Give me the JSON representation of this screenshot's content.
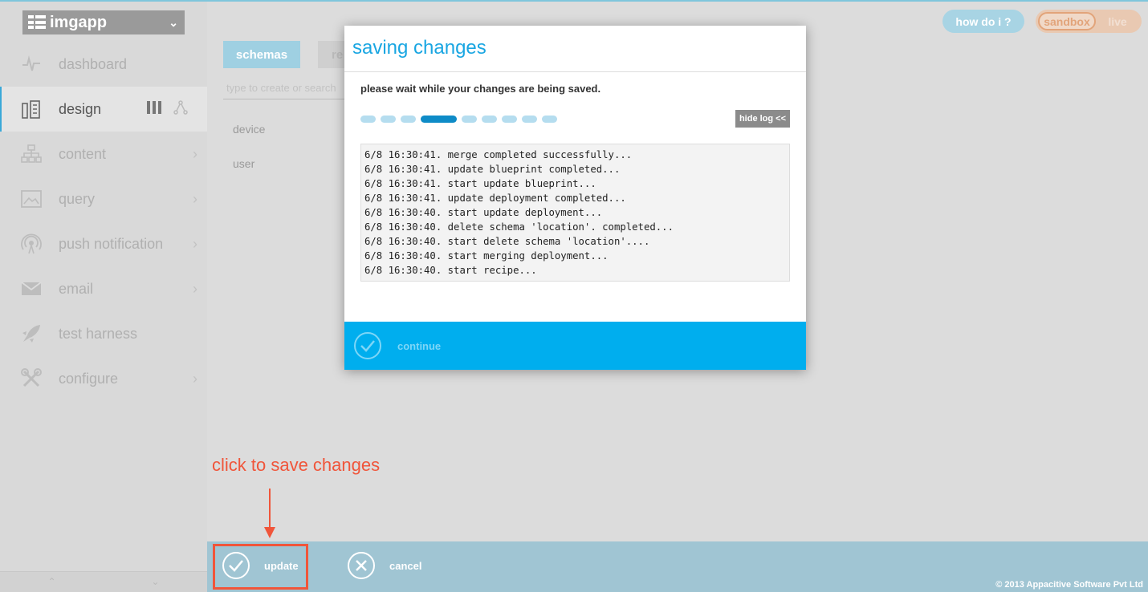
{
  "app": {
    "name": "imgapp"
  },
  "sidebar": {
    "items": [
      {
        "label": "dashboard",
        "icon": "pulse-icon"
      },
      {
        "label": "design",
        "icon": "ruler-icon",
        "active": true
      },
      {
        "label": "content",
        "icon": "sitemap-icon"
      },
      {
        "label": "query",
        "icon": "image-icon"
      },
      {
        "label": "push notification",
        "icon": "broadcast-icon"
      },
      {
        "label": "email",
        "icon": "envelope-icon"
      },
      {
        "label": "test harness",
        "icon": "rocket-icon"
      },
      {
        "label": "configure",
        "icon": "tools-icon"
      }
    ],
    "bottom": {
      "up": "⌃",
      "down": "⌄"
    }
  },
  "main": {
    "tabs": [
      {
        "label": "schemas"
      },
      {
        "label": "re"
      }
    ],
    "search_placeholder": "type to create or search",
    "schemas": [
      "device",
      "user"
    ]
  },
  "topright": {
    "howdoi": "how do i ?",
    "env_active": "sandbox",
    "env_inactive": "live"
  },
  "modal": {
    "title": "saving changes",
    "subtitle": "please wait while your changes are being saved.",
    "hide_log": "hide log <<",
    "progress_step": 4,
    "progress_total": 9,
    "log": [
      "6/8 16:30:41. merge completed successfully...",
      "6/8 16:30:41. update blueprint completed...",
      "6/8 16:30:41. start update blueprint...",
      "6/8 16:30:41. update deployment completed...",
      "6/8 16:30:40. start update deployment...",
      "6/8 16:30:40. delete schema 'location'. completed...",
      "6/8 16:30:40. start delete schema 'location'....",
      "6/8 16:30:40. start merging deployment...",
      "6/8 16:30:40. start recipe..."
    ],
    "continue": "continue"
  },
  "annotation": {
    "text": "click to save changes"
  },
  "bottombar": {
    "update": "update",
    "cancel": "cancel",
    "copyright": "© 2013 Appacitive Software Pvt Ltd"
  },
  "colors": {
    "accent": "#00aeee",
    "annotation": "#f0553a",
    "bar": "#a0c5d3"
  }
}
